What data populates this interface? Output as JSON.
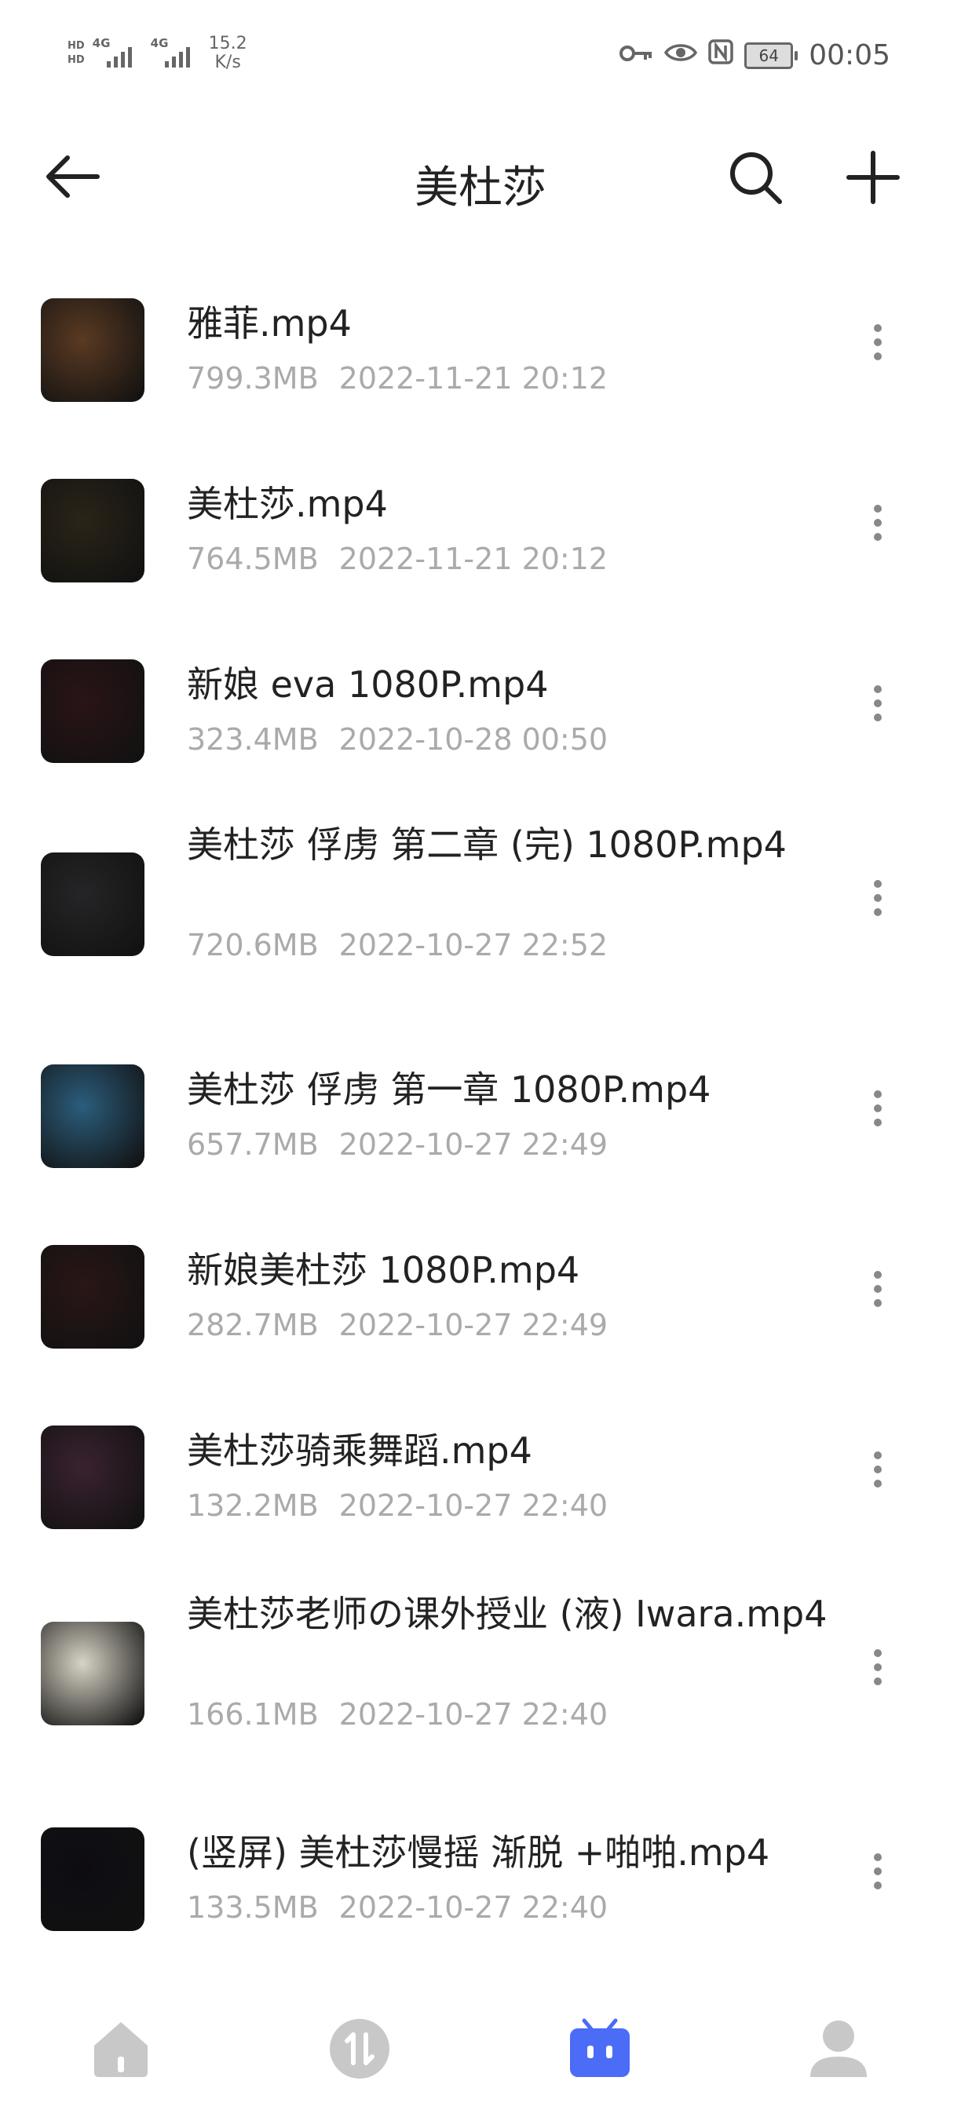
{
  "status_bar": {
    "network": [
      "4G",
      "4G"
    ],
    "speed_value": "15.2",
    "speed_unit": "K/s",
    "battery": "64",
    "time": "00:05"
  },
  "header": {
    "title": "美杜莎"
  },
  "files": [
    {
      "name": "雅菲.mp4",
      "size": "799.3MB",
      "date": "2022-11-21 20:12",
      "thumb_color": "#5a3a22"
    },
    {
      "name": "美杜莎.mp4",
      "size": "764.5MB",
      "date": "2022-11-21 20:12",
      "thumb_color": "#2a2418"
    },
    {
      "name": "新娘 eva 1080P.mp4",
      "size": "323.4MB",
      "date": "2022-10-28 00:50",
      "thumb_color": "#2a1416"
    },
    {
      "name": "美杜莎  俘虏 第二章 (完) 1080P.mp4",
      "size": "720.6MB",
      "date": "2022-10-27 22:52",
      "thumb_color": "#252527"
    },
    {
      "name": "美杜莎  俘虏 第一章 1080P.mp4",
      "size": "657.7MB",
      "date": "2022-10-27 22:49",
      "thumb_color": "#2b5d7c"
    },
    {
      "name": "新娘美杜莎 1080P.mp4",
      "size": "282.7MB",
      "date": "2022-10-27 22:49",
      "thumb_color": "#2a1616"
    },
    {
      "name": "美杜莎骑乘舞蹈.mp4",
      "size": "132.2MB",
      "date": "2022-10-27 22:40",
      "thumb_color": "#3a2230"
    },
    {
      "name": "美杜莎老师の课外授业 (液) Iwara.mp4",
      "size": "166.1MB",
      "date": "2022-10-27 22:40",
      "thumb_color": "#d8d4c6"
    },
    {
      "name": "(竖屏) 美杜莎慢摇  渐脱 +啪啪.mp4",
      "size": "133.5MB",
      "date": "2022-10-27 22:40",
      "thumb_color": "#0e0c12"
    }
  ],
  "bottom_nav": {
    "items": [
      "home-icon",
      "transfer-icon",
      "files-icon",
      "profile-icon"
    ],
    "active": "files-icon",
    "active_color": "#4a6cf7",
    "inactive_color": "#c8c8c8"
  }
}
